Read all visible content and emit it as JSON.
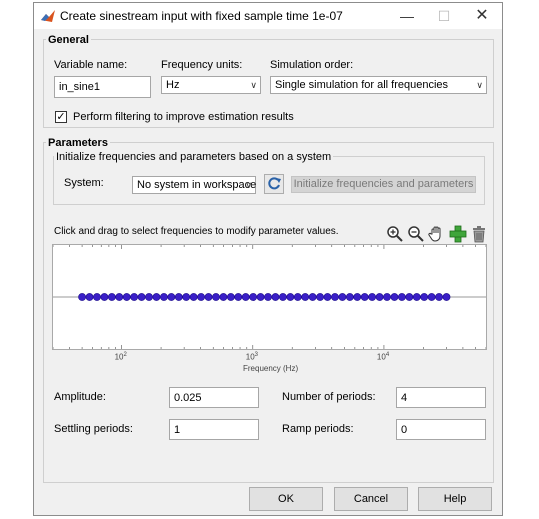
{
  "window": {
    "title": "Create sinestream input with fixed sample time 1e-07",
    "minimize_glyph": "—",
    "maximize_glyph": "☐",
    "close_glyph": "✕"
  },
  "general": {
    "title": "General",
    "variable_name_label": "Variable name:",
    "variable_name_value": "in_sine1",
    "frequency_units_label": "Frequency units:",
    "frequency_units_value": "Hz",
    "simulation_order_label": "Simulation order:",
    "simulation_order_value": "Single simulation for all frequencies",
    "filtering_checked": true,
    "filtering_label": "Perform filtering to improve estimation results"
  },
  "parameters": {
    "title": "Parameters",
    "init_group_title": "Initialize frequencies and parameters based on a system",
    "system_label": "System:",
    "system_value": "No system in workspace",
    "init_button_label": "Initialize frequencies and parameters",
    "instruction": "Click and drag to select frequencies to modify parameter values.",
    "tools": [
      "zoom-in-icon",
      "zoom-out-icon",
      "pan-hand-icon",
      "add-icon",
      "trash-icon"
    ],
    "amplitude_label": "Amplitude:",
    "amplitude_value": "0.025",
    "num_periods_label": "Number of periods:",
    "num_periods_value": "4",
    "settling_label": "Settling periods:",
    "settling_value": "1",
    "ramp_label": "Ramp periods:",
    "ramp_value": "0"
  },
  "plot": {
    "xlabel": "Frequency (Hz)",
    "ticks": [
      {
        "base": "10",
        "exp": "2"
      },
      {
        "base": "10",
        "exp": "3"
      },
      {
        "base": "10",
        "exp": "4"
      }
    ],
    "point_color": "#3a1fc7",
    "point_edge": "#1a0a8a"
  },
  "chart_data": {
    "type": "scatter",
    "xscale": "log",
    "xlabel": "Frequency (Hz)",
    "xlim": [
      30,
      60000
    ],
    "xticks": [
      100,
      1000,
      10000
    ],
    "num_points": 50,
    "freq_min": 50,
    "freq_max": 30000
  },
  "footer": {
    "ok_label": "OK",
    "cancel_label": "Cancel",
    "help_label": "Help"
  }
}
